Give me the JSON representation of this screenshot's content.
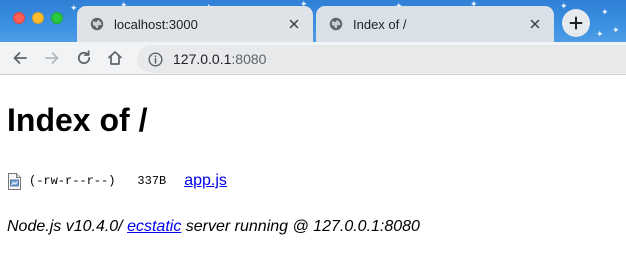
{
  "browser": {
    "tabs": [
      {
        "title": "localhost:3000",
        "icon": "globe-icon",
        "active": false
      },
      {
        "title": "Index of /",
        "icon": "globe-icon",
        "active": true
      }
    ],
    "new_tab_icon": "plus-icon",
    "toolbar_icons": [
      "back-arrow-icon",
      "forward-arrow-icon",
      "reload-icon",
      "home-icon"
    ],
    "address": {
      "host": "127.0.0.1",
      "port": ":8080",
      "icon": "info-icon"
    }
  },
  "page": {
    "heading": "Index of /",
    "files": [
      {
        "icon": "file-icon",
        "permissions": "(-rw-r--r--)",
        "size": "337B",
        "name": "app.js"
      }
    ],
    "footer": {
      "prefix": "Node.js v10.4.0/ ",
      "link_text": "ecstatic",
      "suffix": " server running @ 127.0.0.1:8080"
    }
  },
  "colors": {
    "tabstrip": "#3a8fe2",
    "link": "#0000ee",
    "toolbar": "#f1f3f4"
  }
}
